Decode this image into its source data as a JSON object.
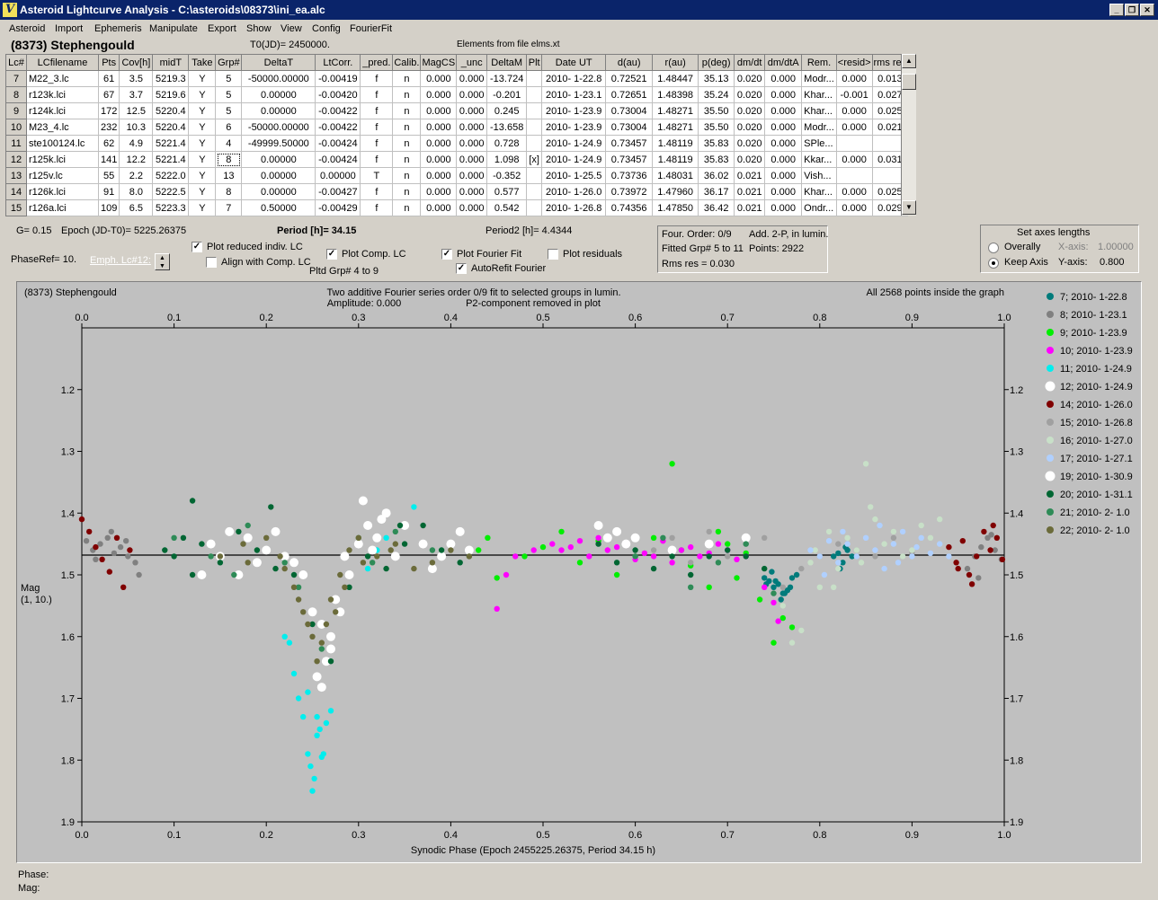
{
  "window": {
    "title": "Asteroid Lightcurve Analysis - C:\\asteroids\\08373\\ini_ea.alc",
    "app_icon": "V"
  },
  "menu": [
    "Asteroid",
    "Import",
    "Ephemeris",
    "Manipulate",
    "Export",
    "Show",
    "View",
    "Config",
    "FourierFit"
  ],
  "header": {
    "asteroid": "(8373) Stephengould",
    "t0": "T0(JD)= 2450000.",
    "elements_source": "Elements from file elms.xt"
  },
  "table": {
    "columns": [
      "Lc#",
      "LCfilename",
      "Pts",
      "Cov[h]",
      "midT",
      "Take",
      "Grp#",
      "DeltaT",
      "LtCorr.",
      "_pred.",
      "Calib.",
      "MagCS",
      "_unc",
      "DeltaM",
      "Plt",
      "Date UT",
      "d(au)",
      "r(au)",
      "p(deg)",
      "dm/dt",
      "dm/dtA",
      "Rem.",
      "<resid>",
      "rms res"
    ],
    "rows": [
      [
        "7",
        "M22_3.lc",
        "61",
        "3.5",
        "5219.3",
        "Y",
        "5",
        "-50000.00000",
        "-0.00419",
        "f",
        "n",
        "0.000",
        "0.000",
        "-13.724",
        "",
        "2010- 1-22.8",
        "0.72521",
        "1.48447",
        "35.13",
        "0.020",
        "0.000",
        "Modr...",
        "0.000",
        "0.013"
      ],
      [
        "8",
        "r123k.lci",
        "67",
        "3.7",
        "5219.6",
        "Y",
        "5",
        "0.00000",
        "-0.00420",
        "f",
        "n",
        "0.000",
        "0.000",
        "-0.201",
        "",
        "2010- 1-23.1",
        "0.72651",
        "1.48398",
        "35.24",
        "0.020",
        "0.000",
        "Khar...",
        "-0.001",
        "0.027"
      ],
      [
        "9",
        "r124k.lci",
        "172",
        "12.5",
        "5220.4",
        "Y",
        "5",
        "0.00000",
        "-0.00422",
        "f",
        "n",
        "0.000",
        "0.000",
        "0.245",
        "",
        "2010- 1-23.9",
        "0.73004",
        "1.48271",
        "35.50",
        "0.020",
        "0.000",
        "Khar...",
        "0.000",
        "0.025"
      ],
      [
        "10",
        "M23_4.lc",
        "232",
        "10.3",
        "5220.4",
        "Y",
        "6",
        "-50000.00000",
        "-0.00422",
        "f",
        "n",
        "0.000",
        "0.000",
        "-13.658",
        "",
        "2010- 1-23.9",
        "0.73004",
        "1.48271",
        "35.50",
        "0.020",
        "0.000",
        "Modr...",
        "0.000",
        "0.021"
      ],
      [
        "11",
        "ste100124.lc",
        "62",
        "4.9",
        "5221.4",
        "Y",
        "4",
        "-49999.50000",
        "-0.00424",
        "f",
        "n",
        "0.000",
        "0.000",
        "0.728",
        "",
        "2010- 1-24.9",
        "0.73457",
        "1.48119",
        "35.83",
        "0.020",
        "0.000",
        "SPle...",
        "",
        ""
      ],
      [
        "12",
        "r125k.lci",
        "141",
        "12.2",
        "5221.4",
        "Y",
        "8",
        "0.00000",
        "-0.00424",
        "f",
        "n",
        "0.000",
        "0.000",
        "1.098",
        "[x]",
        "2010- 1-24.9",
        "0.73457",
        "1.48119",
        "35.83",
        "0.020",
        "0.000",
        "Kkar...",
        "0.000",
        "0.031"
      ],
      [
        "13",
        "r125v.lc",
        "55",
        "2.2",
        "5222.0",
        "Y",
        "13",
        "0.00000",
        "0.00000",
        "T",
        "n",
        "0.000",
        "0.000",
        "-0.352",
        "",
        "2010- 1-25.5",
        "0.73736",
        "1.48031",
        "36.02",
        "0.021",
        "0.000",
        "Vish...",
        "",
        ""
      ],
      [
        "14",
        "r126k.lci",
        "91",
        "8.0",
        "5222.5",
        "Y",
        "8",
        "0.00000",
        "-0.00427",
        "f",
        "n",
        "0.000",
        "0.000",
        "0.577",
        "",
        "2010- 1-26.0",
        "0.73972",
        "1.47960",
        "36.17",
        "0.021",
        "0.000",
        "Khar...",
        "0.000",
        "0.025"
      ],
      [
        "15",
        "r126a.lci",
        "109",
        "6.5",
        "5223.3",
        "Y",
        "7",
        "0.50000",
        "-0.00429",
        "f",
        "n",
        "0.000",
        "0.000",
        "0.542",
        "",
        "2010- 1-26.8",
        "0.74356",
        "1.47850",
        "36.42",
        "0.021",
        "0.000",
        "Ondr...",
        "0.000",
        "0.029"
      ]
    ]
  },
  "controls": {
    "g": "G= 0.15",
    "epoch": "Epoch (JD-T0)= 5225.26375",
    "period": "Period [h]= 34.15",
    "period2": "Period2 [h]= 4.4344",
    "phaseref": "PhaseRef= 10.",
    "emph": "Emph. Lc#12:",
    "plot_reduced": "Plot reduced indiv. LC",
    "align_comp": "Align with Comp. LC",
    "plot_comp": "Plot Comp. LC",
    "pltd_grp": "Pltd Grp#  4   to    9",
    "plot_fourier": "Plot Fourier Fit",
    "autorefit": "AutoRefit Fourier",
    "plot_residuals": "Plot residuals",
    "fourier_order": "Four. Order:  0/9",
    "add2p": "Add. 2-P, in lumin.",
    "fitted_grp": "Fitted Grp# 5 to 11",
    "points": "Points: 2922",
    "rms": "Rms res     = 0.030"
  },
  "axes_panel": {
    "title": "Set axes lengths",
    "overally": "Overally",
    "keep": "Keep Axis",
    "xaxis_label": "X-axis:",
    "xaxis_value": "1.00000",
    "yaxis_label": "Y-axis:",
    "yaxis_value": "0.800"
  },
  "plot": {
    "object": "(8373) Stephengould",
    "title1": "Two additive Fourier series order 0/9 fit to selected groups in lumin.",
    "amplitude": "Amplitude: 0.000",
    "p2_removed": "P2-component removed in plot",
    "points_inside": "All 2568 points inside the graph",
    "ylabel": "Mag",
    "ylabel2": "(1, 10.)",
    "xlabel": "Synodic Phase (Epoch 2455225.26375, Period 34.15 h)",
    "phase_label": "Phase:",
    "mag_label": "Mag:"
  },
  "chart_data": {
    "type": "scatter",
    "x_range": [
      0.0,
      1.0
    ],
    "y_range": [
      1.9,
      1.1
    ],
    "y_inverted": true,
    "x_ticks": [
      "0.0",
      "0.1",
      "0.2",
      "0.3",
      "0.4",
      "0.5",
      "0.6",
      "0.7",
      "0.8",
      "0.9",
      "1.0"
    ],
    "y_ticks": [
      "1.2",
      "1.3",
      "1.4",
      "1.5",
      "1.6",
      "1.7",
      "1.8",
      "1.9"
    ],
    "fit_line_mag": 1.468,
    "series": [
      {
        "name": "7; 2010- 1-22.8",
        "color": "#007b7b",
        "x": [
          0.74,
          0.745,
          0.75,
          0.755,
          0.76,
          0.765,
          0.77,
          0.748,
          0.758,
          0.768,
          0.775,
          0.742,
          0.752,
          0.762,
          0.815,
          0.82,
          0.825,
          0.83,
          0.835,
          0.822,
          0.828
        ],
        "y": [
          1.505,
          1.51,
          1.52,
          1.515,
          1.53,
          1.525,
          1.505,
          1.495,
          1.54,
          1.52,
          1.5,
          1.515,
          1.51,
          1.53,
          1.47,
          1.465,
          1.48,
          1.46,
          1.47,
          1.49,
          1.455
        ]
      },
      {
        "name": "8; 2010- 1-23.1",
        "color": "#808080",
        "x": [
          0.005,
          0.012,
          0.02,
          0.028,
          0.035,
          0.042,
          0.05,
          0.058,
          0.015,
          0.032,
          0.048,
          0.062,
          0.96,
          0.968,
          0.975,
          0.982,
          0.99,
          0.997,
          0.972,
          0.986
        ],
        "y": [
          1.445,
          1.46,
          1.45,
          1.44,
          1.465,
          1.455,
          1.47,
          1.48,
          1.475,
          1.43,
          1.445,
          1.5,
          1.49,
          1.47,
          1.455,
          1.44,
          1.46,
          1.475,
          1.505,
          1.435
        ]
      },
      {
        "name": "9; 2010- 1-23.9",
        "color": "#00ee00",
        "x": [
          0.43,
          0.44,
          0.45,
          0.48,
          0.5,
          0.52,
          0.54,
          0.56,
          0.58,
          0.6,
          0.62,
          0.64,
          0.66,
          0.68,
          0.7,
          0.72,
          0.735,
          0.75,
          0.76,
          0.77,
          0.69,
          0.71,
          0.65
        ],
        "y": [
          1.46,
          1.44,
          1.505,
          1.47,
          1.455,
          1.43,
          1.48,
          1.445,
          1.5,
          1.47,
          1.44,
          1.32,
          1.485,
          1.52,
          1.45,
          1.465,
          1.54,
          1.61,
          1.57,
          1.585,
          1.43,
          1.505,
          1.46
        ]
      },
      {
        "name": "10; 2010- 1-23.9",
        "color": "#ff00ff",
        "x": [
          0.45,
          0.46,
          0.47,
          0.49,
          0.51,
          0.52,
          0.53,
          0.54,
          0.55,
          0.56,
          0.57,
          0.58,
          0.59,
          0.6,
          0.61,
          0.62,
          0.63,
          0.64,
          0.65,
          0.66,
          0.67,
          0.68,
          0.69,
          0.7,
          0.71,
          0.72,
          0.74,
          0.75,
          0.755
        ],
        "y": [
          1.555,
          1.5,
          1.47,
          1.46,
          1.45,
          1.46,
          1.455,
          1.445,
          1.47,
          1.44,
          1.46,
          1.455,
          1.45,
          1.475,
          1.465,
          1.47,
          1.445,
          1.48,
          1.46,
          1.455,
          1.47,
          1.465,
          1.45,
          1.46,
          1.475,
          1.47,
          1.52,
          1.545,
          1.575
        ]
      },
      {
        "name": "11; 2010- 1-24.9",
        "color": "#00eeee",
        "x": [
          0.22,
          0.225,
          0.23,
          0.235,
          0.24,
          0.245,
          0.25,
          0.255,
          0.26,
          0.265,
          0.27,
          0.252,
          0.258,
          0.248,
          0.262,
          0.31,
          0.32,
          0.33,
          0.34,
          0.36,
          0.245,
          0.255
        ],
        "y": [
          1.6,
          1.61,
          1.66,
          1.7,
          1.73,
          1.79,
          1.85,
          1.76,
          1.795,
          1.74,
          1.72,
          1.83,
          1.75,
          1.81,
          1.79,
          1.49,
          1.46,
          1.44,
          1.47,
          1.39,
          1.69,
          1.73
        ]
      },
      {
        "name": "12; 2010- 1-24.9",
        "color": "#ffffff",
        "x": [
          0.13,
          0.14,
          0.15,
          0.16,
          0.17,
          0.18,
          0.19,
          0.2,
          0.21,
          0.22,
          0.23,
          0.24,
          0.25,
          0.26,
          0.27,
          0.28,
          0.29,
          0.3,
          0.31,
          0.32,
          0.33,
          0.34,
          0.35,
          0.37,
          0.38,
          0.39,
          0.4,
          0.41,
          0.42,
          0.27,
          0.265,
          0.255,
          0.26,
          0.275,
          0.285,
          0.305,
          0.315,
          0.325
        ],
        "y": [
          1.5,
          1.45,
          1.47,
          1.43,
          1.5,
          1.44,
          1.48,
          1.46,
          1.43,
          1.47,
          1.48,
          1.5,
          1.56,
          1.58,
          1.62,
          1.56,
          1.5,
          1.45,
          1.42,
          1.44,
          1.4,
          1.47,
          1.42,
          1.45,
          1.49,
          1.47,
          1.45,
          1.43,
          1.46,
          1.6,
          1.64,
          1.665,
          1.682,
          1.54,
          1.47,
          1.38,
          1.46,
          1.41
        ]
      },
      {
        "name": "14; 2010- 1-26.0",
        "color": "#800000",
        "x": [
          0.0,
          0.008,
          0.015,
          0.022,
          0.03,
          0.038,
          0.045,
          0.052,
          0.94,
          0.948,
          0.955,
          0.962,
          0.97,
          0.978,
          0.985,
          0.992,
          0.998,
          0.965,
          0.95,
          0.988
        ],
        "y": [
          1.41,
          1.43,
          1.455,
          1.475,
          1.495,
          1.44,
          1.52,
          1.46,
          1.455,
          1.48,
          1.445,
          1.5,
          1.47,
          1.43,
          1.46,
          1.44,
          1.475,
          1.515,
          1.49,
          1.42
        ]
      },
      {
        "name": "15; 2010- 1-26.8",
        "color": "#a0a0a0",
        "x": [
          0.6,
          0.62,
          0.64,
          0.66,
          0.68,
          0.7,
          0.72,
          0.74,
          0.76,
          0.78,
          0.8,
          0.82,
          0.84,
          0.86,
          0.88,
          0.9
        ],
        "y": [
          1.47,
          1.46,
          1.44,
          1.48,
          1.43,
          1.47,
          1.45,
          1.44,
          1.52,
          1.49,
          1.47,
          1.45,
          1.46,
          1.47,
          1.44,
          1.465
        ]
      },
      {
        "name": "16; 2010- 1-27.0",
        "color": "#c8e0c8",
        "x": [
          0.76,
          0.77,
          0.78,
          0.79,
          0.8,
          0.81,
          0.82,
          0.83,
          0.84,
          0.85,
          0.86,
          0.87,
          0.88,
          0.89,
          0.9,
          0.91,
          0.92,
          0.93,
          0.795,
          0.815,
          0.845,
          0.855
        ],
        "y": [
          1.55,
          1.61,
          1.59,
          1.48,
          1.52,
          1.43,
          1.49,
          1.44,
          1.46,
          1.32,
          1.41,
          1.45,
          1.43,
          1.47,
          1.46,
          1.42,
          1.44,
          1.41,
          1.46,
          1.52,
          1.48,
          1.39
        ]
      },
      {
        "name": "17; 2010- 1-27.1",
        "color": "#b0d0ff",
        "x": [
          0.79,
          0.8,
          0.81,
          0.82,
          0.83,
          0.84,
          0.85,
          0.86,
          0.87,
          0.88,
          0.89,
          0.9,
          0.91,
          0.92,
          0.93,
          0.94,
          0.805,
          0.825,
          0.865,
          0.885,
          0.905
        ],
        "y": [
          1.46,
          1.47,
          1.445,
          1.48,
          1.45,
          1.47,
          1.44,
          1.46,
          1.49,
          1.45,
          1.43,
          1.47,
          1.44,
          1.465,
          1.45,
          1.47,
          1.5,
          1.43,
          1.42,
          1.48,
          1.455
        ]
      },
      {
        "name": "19; 2010- 1-30.9",
        "color": "#ffffff",
        "x": [
          0.56,
          0.57,
          0.58,
          0.59,
          0.6,
          0.64,
          0.68,
          0.72
        ],
        "y": [
          1.42,
          1.44,
          1.43,
          1.45,
          1.44,
          1.46,
          1.45,
          1.44
        ]
      },
      {
        "name": "20; 2010- 1-31.1",
        "color": "#006633",
        "x": [
          0.09,
          0.1,
          0.11,
          0.12,
          0.13,
          0.15,
          0.17,
          0.19,
          0.21,
          0.23,
          0.25,
          0.27,
          0.29,
          0.31,
          0.33,
          0.35,
          0.37,
          0.39,
          0.41,
          0.56,
          0.58,
          0.6,
          0.62,
          0.64,
          0.66,
          0.68,
          0.7,
          0.72,
          0.74,
          0.12,
          0.205,
          0.345
        ],
        "y": [
          1.46,
          1.47,
          1.44,
          1.5,
          1.45,
          1.48,
          1.43,
          1.46,
          1.49,
          1.5,
          1.58,
          1.64,
          1.52,
          1.47,
          1.49,
          1.45,
          1.42,
          1.46,
          1.48,
          1.45,
          1.48,
          1.46,
          1.49,
          1.47,
          1.5,
          1.47,
          1.46,
          1.47,
          1.49,
          1.38,
          1.39,
          1.42
        ]
      },
      {
        "name": "21; 2010- 2- 1.0",
        "color": "#2e8b57",
        "x": [
          0.1,
          0.14,
          0.18,
          0.22,
          0.26,
          0.3,
          0.34,
          0.38,
          0.42,
          0.6,
          0.63,
          0.66,
          0.69,
          0.72,
          0.75,
          0.165,
          0.235,
          0.315
        ],
        "y": [
          1.44,
          1.47,
          1.42,
          1.48,
          1.62,
          1.44,
          1.43,
          1.46,
          1.47,
          1.47,
          1.44,
          1.52,
          1.48,
          1.45,
          1.53,
          1.5,
          1.52,
          1.48
        ]
      },
      {
        "name": "22; 2010- 2- 1.0",
        "color": "#6b6b3a",
        "x": [
          0.15,
          0.18,
          0.2,
          0.22,
          0.23,
          0.24,
          0.25,
          0.255,
          0.26,
          0.265,
          0.27,
          0.28,
          0.29,
          0.3,
          0.32,
          0.34,
          0.36,
          0.38,
          0.4,
          0.42,
          0.175,
          0.215,
          0.235,
          0.245,
          0.275,
          0.285,
          0.305,
          0.335
        ],
        "y": [
          1.47,
          1.48,
          1.44,
          1.49,
          1.52,
          1.56,
          1.6,
          1.64,
          1.61,
          1.58,
          1.54,
          1.5,
          1.46,
          1.44,
          1.47,
          1.45,
          1.49,
          1.48,
          1.46,
          1.47,
          1.45,
          1.47,
          1.54,
          1.58,
          1.56,
          1.52,
          1.48,
          1.46
        ]
      }
    ]
  }
}
